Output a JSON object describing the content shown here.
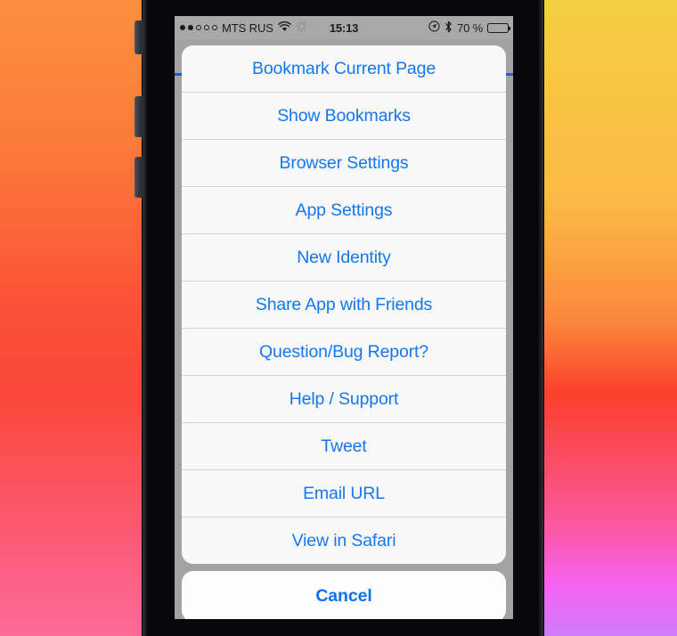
{
  "status_bar": {
    "signal_dots_total": 5,
    "signal_dots_filled": 2,
    "carrier": "MTS RUS",
    "wifi_icon": "wifi-icon",
    "activity_icon": "activity-spinner-icon",
    "time": "15:13",
    "location_icon": "location-arrow-icon",
    "bluetooth_icon": "bluetooth-icon",
    "battery_percent": "70 %",
    "battery_level": 70,
    "battery_icon": "battery-icon"
  },
  "action_sheet": {
    "items": [
      {
        "label": "Bookmark Current Page"
      },
      {
        "label": "Show Bookmarks"
      },
      {
        "label": "Browser Settings"
      },
      {
        "label": "App Settings"
      },
      {
        "label": "New Identity"
      },
      {
        "label": "Share App with Friends"
      },
      {
        "label": "Question/Bug Report?"
      },
      {
        "label": "Help / Support"
      },
      {
        "label": "Tweet"
      },
      {
        "label": "Email URL"
      },
      {
        "label": "View in Safari"
      }
    ],
    "cancel_label": "Cancel"
  },
  "colors": {
    "tint_blue": "#1577ef",
    "cancel_blue": "#0a73f5",
    "sheet_background": "#f8f8f8",
    "backdrop_gray": "#a3a3a3",
    "progress_blue": "#1a5fd6",
    "separator": "#d3d4d6"
  }
}
